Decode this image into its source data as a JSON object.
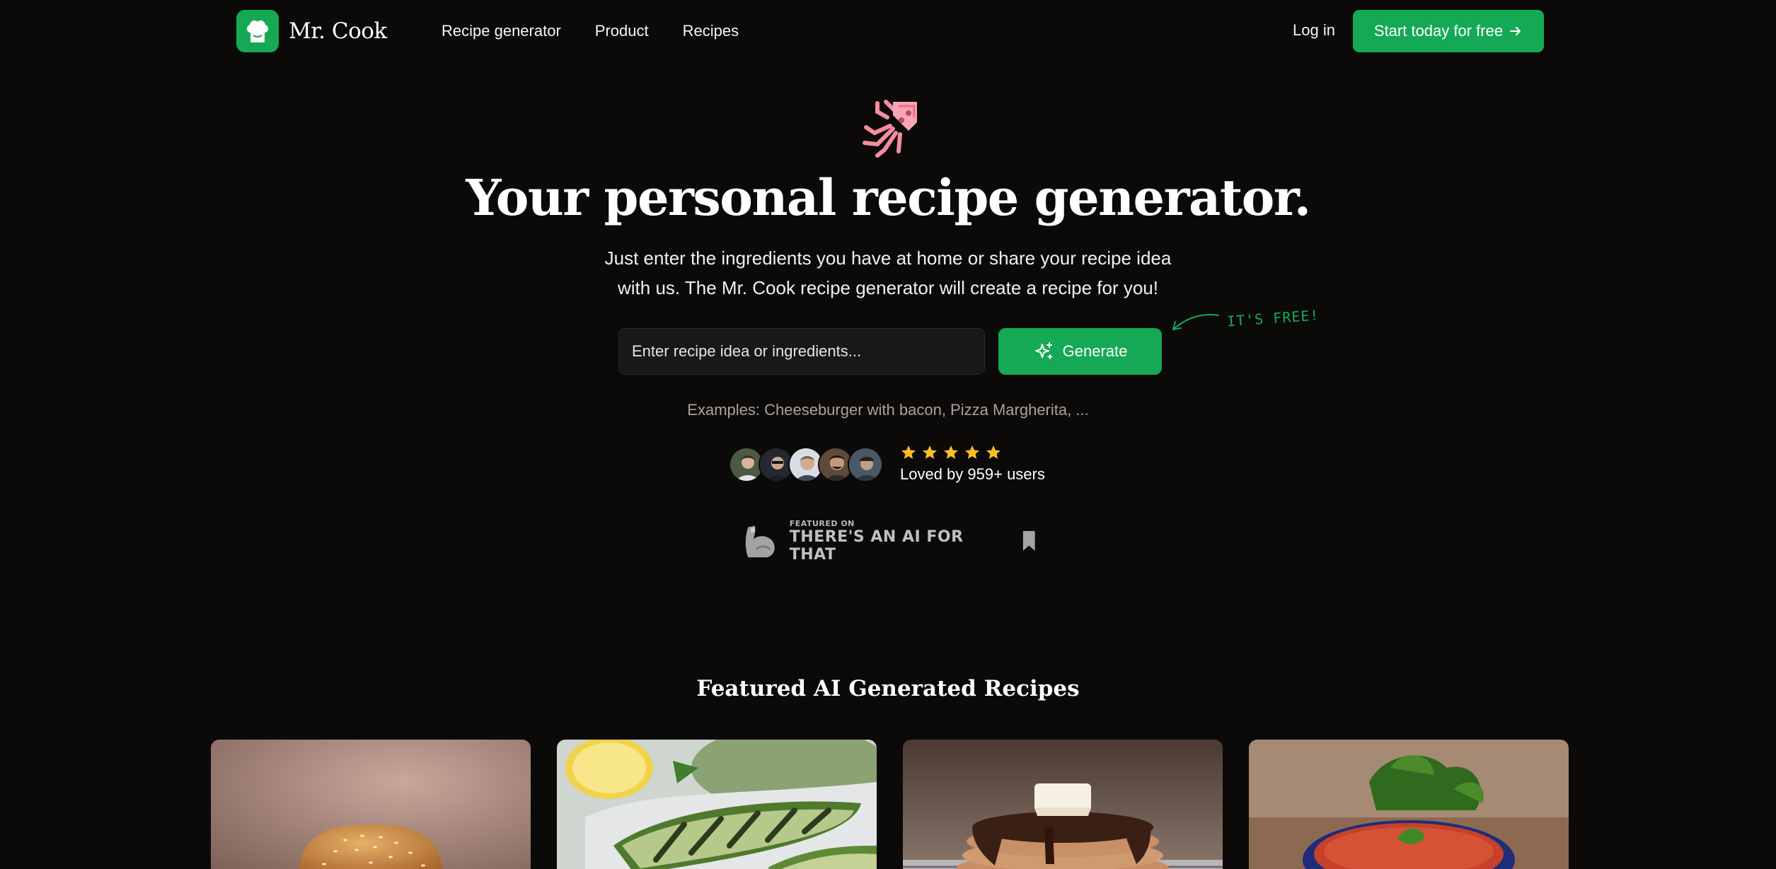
{
  "nav": {
    "brand": "Mr. Cook",
    "links": [
      "Recipe generator",
      "Product",
      "Recipes"
    ],
    "login": "Log in",
    "cta": "Start today for free"
  },
  "hero": {
    "emoji": "squid",
    "title": "Your personal recipe generator.",
    "subtitle": "Just enter the ingredients you have at home or share your recipe idea with us. The Mr. Cook recipe generator will create a recipe for you!"
  },
  "search": {
    "placeholder": "Enter recipe idea or ingredients...",
    "button": "Generate",
    "free_note": "IT'S FREE!",
    "examples": "Examples: Cheeseburger with bacon, Pizza Margherita, ..."
  },
  "social": {
    "avatar_count": 5,
    "stars": 5,
    "loved": "Loved by 959+ users"
  },
  "featured_on": {
    "small": "FEATURED ON",
    "big": "THERE'S AN AI FOR THAT"
  },
  "recipes": {
    "title": "Featured AI Generated Recipes",
    "cards": [
      {
        "image": "cheeseburger"
      },
      {
        "image": "grilled-zucchini"
      },
      {
        "image": "chocolate-pancakes"
      },
      {
        "image": "tomato-sauce-with-parsley"
      }
    ]
  },
  "colors": {
    "background": "#0b0a09",
    "accent": "#16a955",
    "text": "#ffffff",
    "muted": "#a8a29e",
    "star": "#fbbf24"
  }
}
